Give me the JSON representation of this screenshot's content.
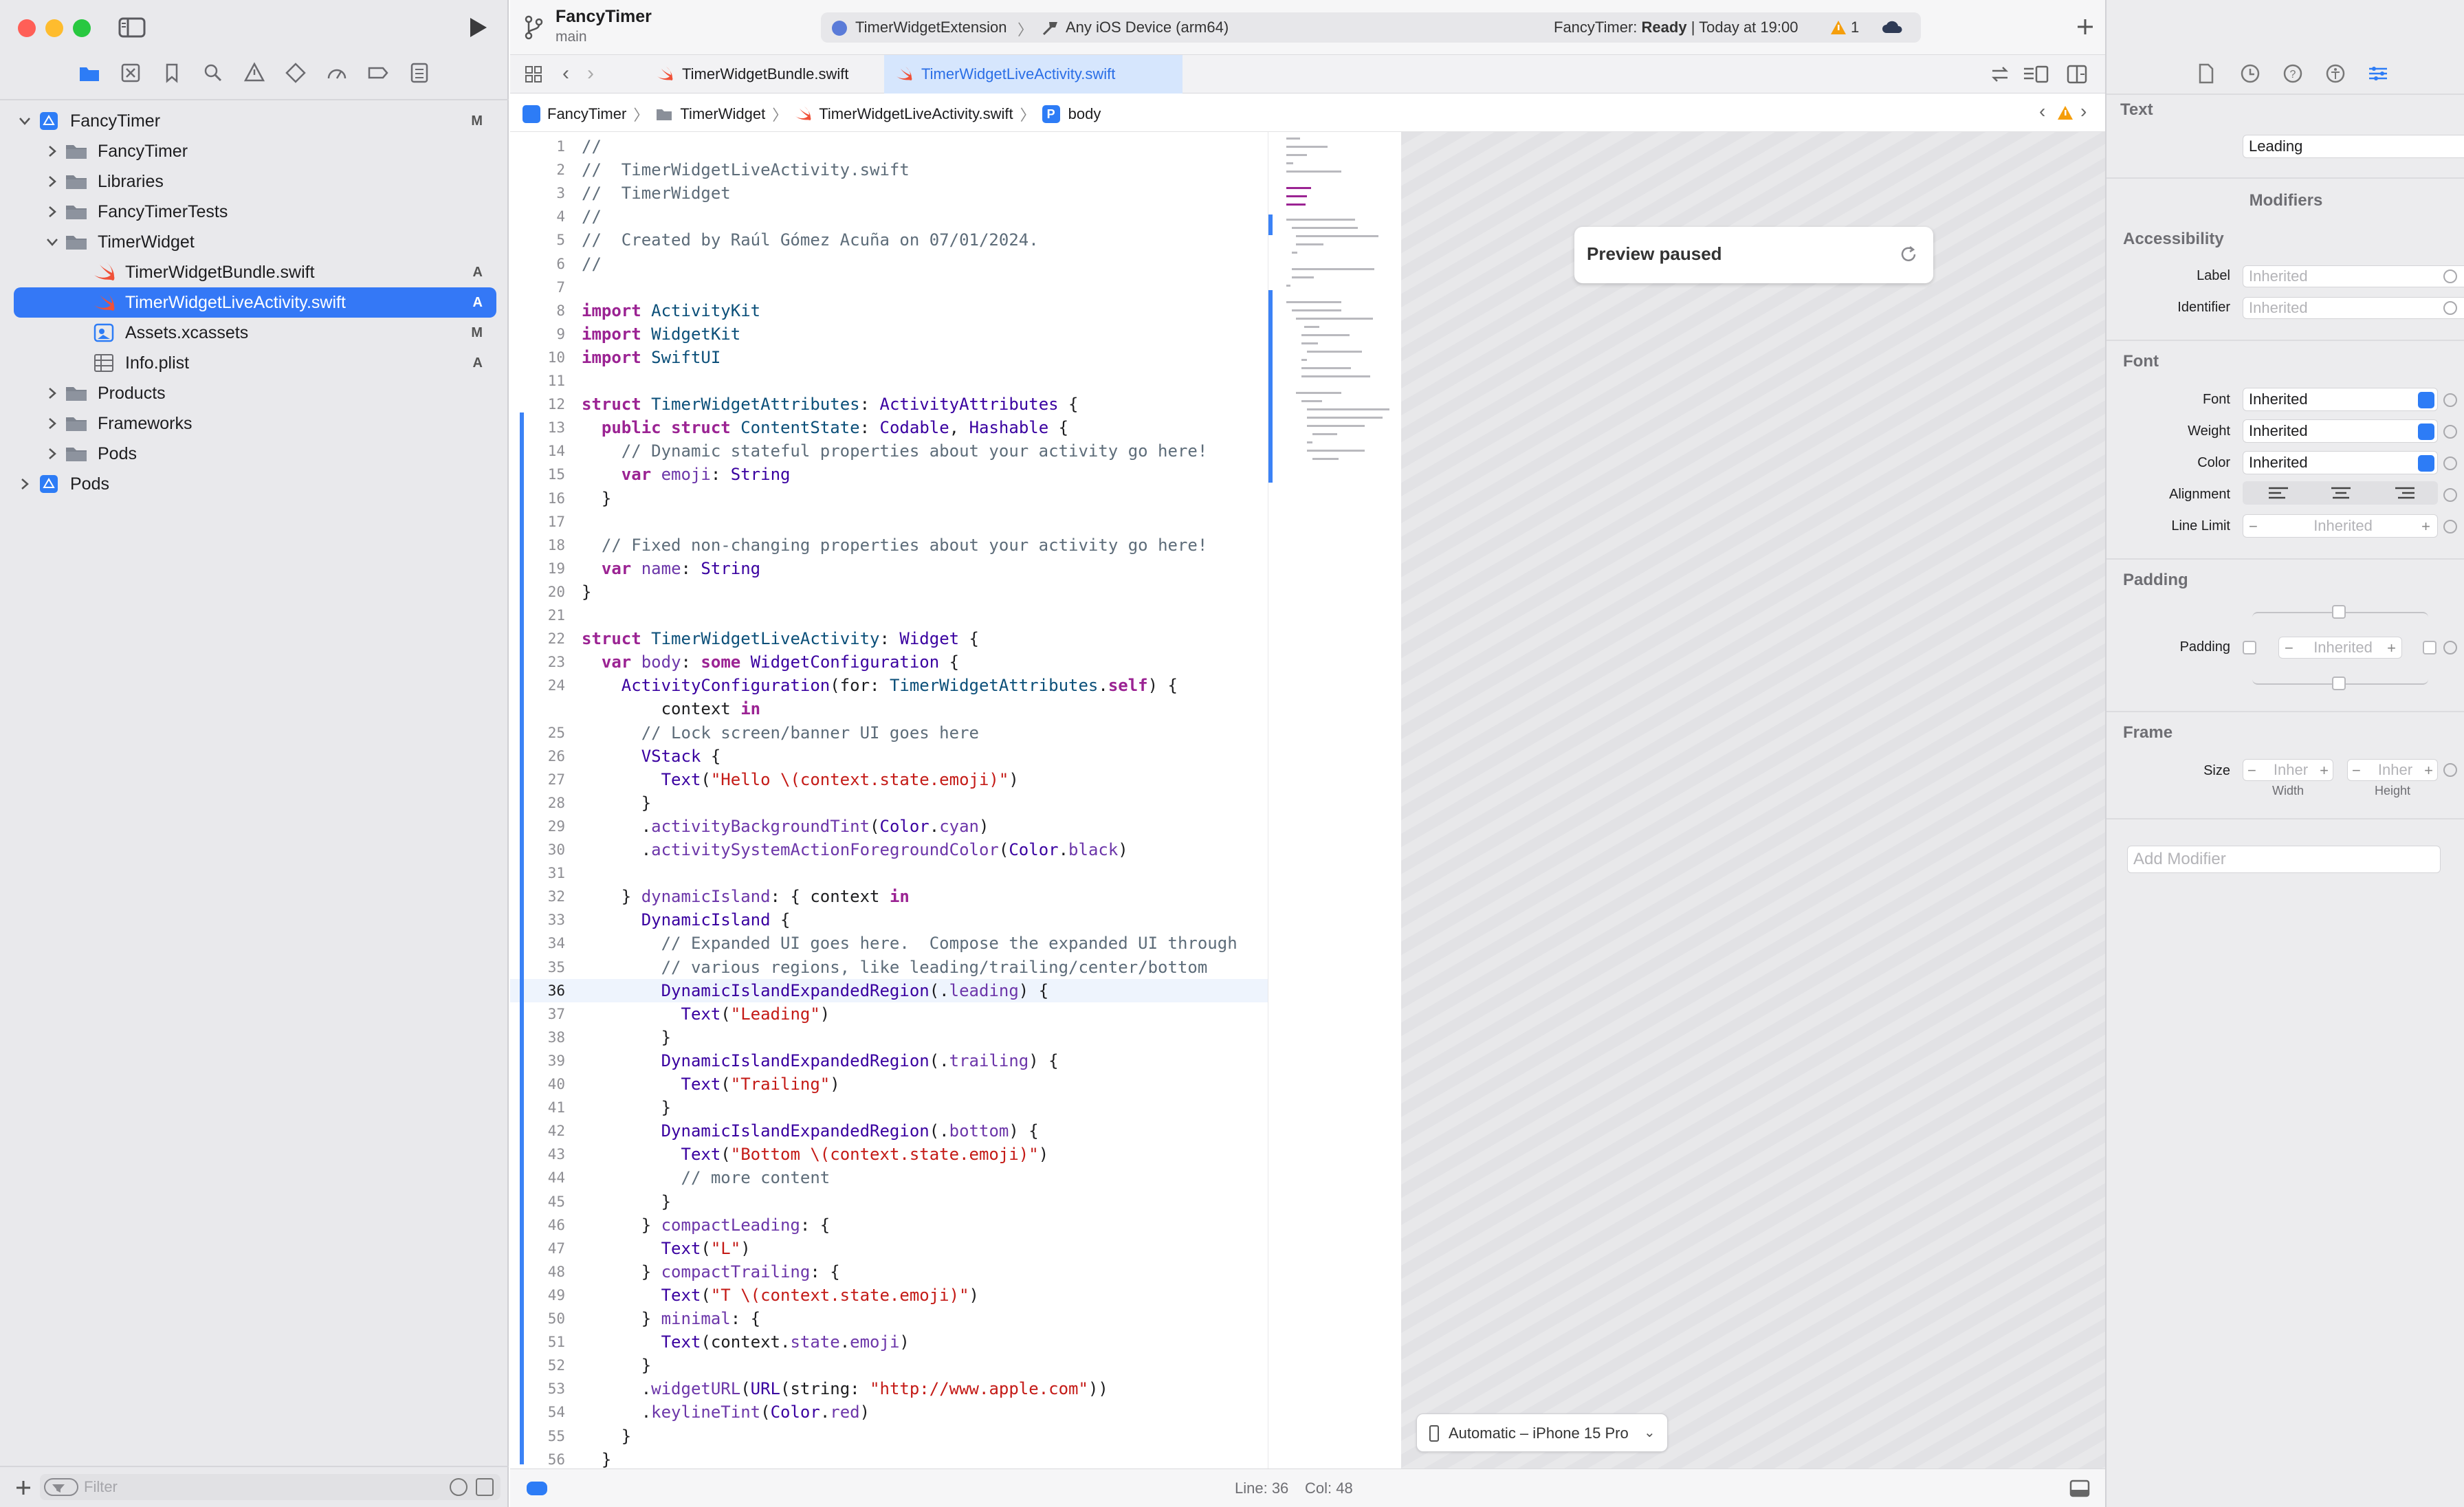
{
  "window": {
    "project": "FancyTimer",
    "branch": "main",
    "scheme": "TimerWidgetExtension",
    "destination": "Any iOS Device (arm64)",
    "status_prefix": "FancyTimer: ",
    "status_state": "Ready",
    "status_time": " | Today at 19:00",
    "warning_count": "1"
  },
  "navigator": {
    "tree": [
      {
        "label": "FancyTimer",
        "badge": "M",
        "icon": "project-icon"
      },
      {
        "label": "FancyTimer",
        "badge": "",
        "icon": "folder-icon"
      },
      {
        "label": "Libraries",
        "badge": "",
        "icon": "folder-icon"
      },
      {
        "label": "FancyTimerTests",
        "badge": "",
        "icon": "folder-icon"
      },
      {
        "label": "TimerWidget",
        "badge": "",
        "icon": "folder-icon"
      },
      {
        "label": "TimerWidgetBundle.swift",
        "badge": "A",
        "icon": "swift-file-icon"
      },
      {
        "label": "TimerWidgetLiveActivity.swift",
        "badge": "A",
        "icon": "swift-file-icon"
      },
      {
        "label": "Assets.xcassets",
        "badge": "M",
        "icon": "asset-catalog-icon"
      },
      {
        "label": "Info.plist",
        "badge": "A",
        "icon": "plist-icon"
      },
      {
        "label": "Products",
        "badge": "",
        "icon": "folder-icon"
      },
      {
        "label": "Frameworks",
        "badge": "",
        "icon": "folder-icon"
      },
      {
        "label": "Pods",
        "badge": "",
        "icon": "folder-icon"
      },
      {
        "label": "Pods",
        "badge": "",
        "icon": "project-icon"
      }
    ],
    "filter_placeholder": "Filter"
  },
  "tabs": [
    {
      "label": "TimerWidgetBundle.swift"
    },
    {
      "label": "TimerWidgetLiveActivity.swift"
    }
  ],
  "jumpbar": {
    "crumbs": [
      "FancyTimer",
      "TimerWidget",
      "TimerWidgetLiveActivity.swift",
      "body"
    ]
  },
  "editor": {
    "lines": [
      {
        "n": "1",
        "t": "//"
      },
      {
        "n": "2",
        "t": "//  TimerWidgetLiveActivity.swift"
      },
      {
        "n": "3",
        "t": "//  TimerWidget"
      },
      {
        "n": "4",
        "t": "//"
      },
      {
        "n": "5",
        "t": "//  Created by Raúl Gómez Acuña on 07/01/2024."
      },
      {
        "n": "6",
        "t": "//"
      },
      {
        "n": "7",
        "t": ""
      },
      {
        "n": "8",
        "t": "import ActivityKit"
      },
      {
        "n": "9",
        "t": "import WidgetKit"
      },
      {
        "n": "10",
        "t": "import SwiftUI"
      },
      {
        "n": "11",
        "t": ""
      },
      {
        "n": "12",
        "t": "struct TimerWidgetAttributes: ActivityAttributes {"
      },
      {
        "n": "13",
        "t": "  public struct ContentState: Codable, Hashable {"
      },
      {
        "n": "14",
        "t": "    // Dynamic stateful properties about your activity go here!"
      },
      {
        "n": "15",
        "t": "    var emoji: String"
      },
      {
        "n": "16",
        "t": "  }"
      },
      {
        "n": "17",
        "t": ""
      },
      {
        "n": "18",
        "t": "  // Fixed non-changing properties about your activity go here!"
      },
      {
        "n": "19",
        "t": "  var name: String"
      },
      {
        "n": "20",
        "t": "}"
      },
      {
        "n": "21",
        "t": ""
      },
      {
        "n": "22",
        "t": "struct TimerWidgetLiveActivity: Widget {"
      },
      {
        "n": "23",
        "t": "  var body: some WidgetConfiguration {"
      },
      {
        "n": "24",
        "t": "    ActivityConfiguration(for: TimerWidgetAttributes.self) {"
      },
      {
        "n": "",
        "t": "        context in"
      },
      {
        "n": "25",
        "t": "      // Lock screen/banner UI goes here"
      },
      {
        "n": "26",
        "t": "      VStack {"
      },
      {
        "n": "27",
        "t": "        Text(\"Hello \\(context.state.emoji)\")"
      },
      {
        "n": "28",
        "t": "      }"
      },
      {
        "n": "29",
        "t": "      .activityBackgroundTint(Color.cyan)"
      },
      {
        "n": "30",
        "t": "      .activitySystemActionForegroundColor(Color.black)"
      },
      {
        "n": "31",
        "t": ""
      },
      {
        "n": "32",
        "t": "    } dynamicIsland: { context in"
      },
      {
        "n": "33",
        "t": "      DynamicIsland {"
      },
      {
        "n": "34",
        "t": "        // Expanded UI goes here.  Compose the expanded UI through"
      },
      {
        "n": "35",
        "t": "        // various regions, like leading/trailing/center/bottom"
      },
      {
        "n": "36",
        "t": "        DynamicIslandExpandedRegion(.leading) {"
      },
      {
        "n": "37",
        "t": "          Text(\"Leading\")"
      },
      {
        "n": "38",
        "t": "        }"
      },
      {
        "n": "39",
        "t": "        DynamicIslandExpandedRegion(.trailing) {"
      },
      {
        "n": "40",
        "t": "          Text(\"Trailing\")"
      },
      {
        "n": "41",
        "t": "        }"
      },
      {
        "n": "42",
        "t": "        DynamicIslandExpandedRegion(.bottom) {"
      },
      {
        "n": "43",
        "t": "          Text(\"Bottom \\(context.state.emoji)\")"
      },
      {
        "n": "44",
        "t": "          // more content"
      },
      {
        "n": "45",
        "t": "        }"
      },
      {
        "n": "46",
        "t": "      } compactLeading: {"
      },
      {
        "n": "47",
        "t": "        Text(\"L\")"
      },
      {
        "n": "48",
        "t": "      } compactTrailing: {"
      },
      {
        "n": "49",
        "t": "        Text(\"T \\(context.state.emoji)\")"
      },
      {
        "n": "50",
        "t": "      } minimal: {"
      },
      {
        "n": "51",
        "t": "        Text(context.state.emoji)"
      },
      {
        "n": "52",
        "t": "      }"
      },
      {
        "n": "53",
        "t": "      .widgetURL(URL(string: \"http://www.apple.com\"))"
      },
      {
        "n": "54",
        "t": "      .keylineTint(Color.red)"
      },
      {
        "n": "55",
        "t": "    }"
      },
      {
        "n": "56",
        "t": "  }"
      }
    ],
    "current_line": "36"
  },
  "preview": {
    "paused_label": "Preview paused",
    "device_label": "Automatic – iPhone 15 Pro"
  },
  "statusbar": {
    "line_label": "Line: 36",
    "col_label": "Col: 48"
  },
  "inspector": {
    "text_header": "Text",
    "text_value": "Leading",
    "modifiers_header": "Modifiers",
    "accessibility_header": "Accessibility",
    "label_label": "Label",
    "label_placeholder": "Inherited",
    "identifier_label": "Identifier",
    "identifier_placeholder": "Inherited",
    "font_header": "Font",
    "font_label": "Font",
    "font_value": "Inherited",
    "weight_label": "Weight",
    "weight_value": "Inherited",
    "color_label": "Color",
    "color_value": "Inherited",
    "alignment_label": "Alignment",
    "line_limit_label": "Line Limit",
    "line_limit_value": "Inherited",
    "padding_header": "Padding",
    "padding_label": "Padding",
    "padding_value": "Inherited",
    "frame_header": "Frame",
    "size_label": "Size",
    "width_value": "Inher",
    "height_value": "Inher",
    "width_caption": "Width",
    "height_caption": "Height",
    "add_modifier_placeholder": "Add Modifier"
  },
  "colors": {
    "accent": "#3478f6",
    "keyword": "#9b2393",
    "type": "#0b4f79",
    "string": "#c41a16",
    "comment": "#5d6c79",
    "warning": "#f59e0b"
  }
}
